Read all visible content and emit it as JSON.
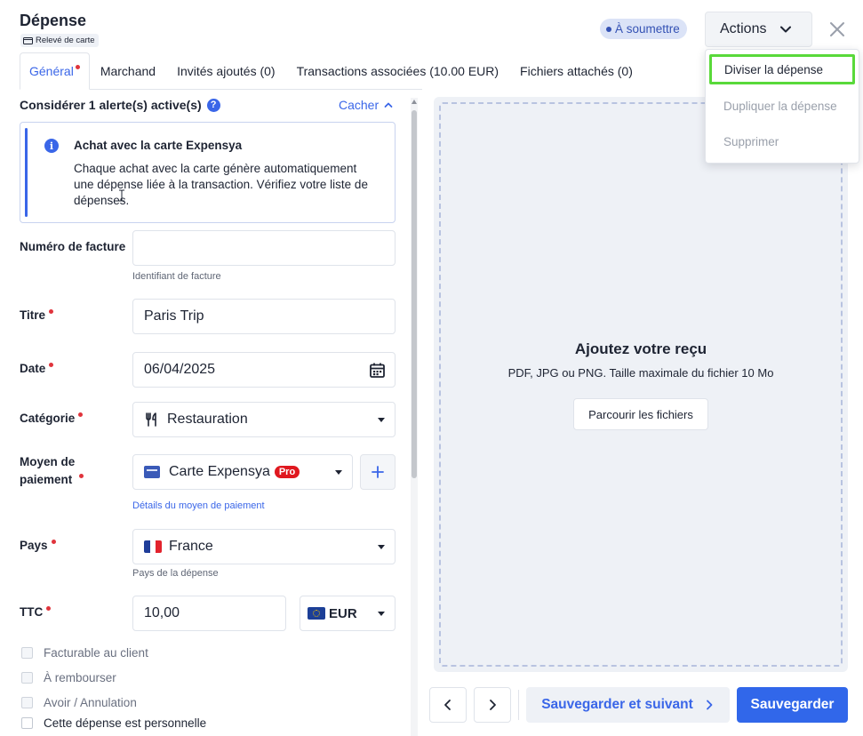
{
  "header": {
    "title": "Dépense",
    "source_badge": "Relevé de carte",
    "status": "À soumettre",
    "actions_label": "Actions"
  },
  "tabs": [
    {
      "label": "Général",
      "active": true,
      "required": true
    },
    {
      "label": "Marchand"
    },
    {
      "label": "Invités ajoutés (0)"
    },
    {
      "label": "Transactions associées (10.00 EUR)"
    },
    {
      "label": "Fichiers attachés (0)"
    }
  ],
  "alerts": {
    "heading": "Considérer 1 alerte(s) active(s)",
    "toggle": "Cacher",
    "box_title": "Achat avec la carte Expensya",
    "box_text": "Chaque achat avec la carte génère automatiquement une dépense liée à la transaction. Vérifiez votre liste de dépenses."
  },
  "form": {
    "invoice": {
      "label": "Numéro de facture",
      "value": "",
      "hint": "Identifiant de facture"
    },
    "title": {
      "label": "Titre",
      "value": "Paris Trip"
    },
    "date": {
      "label": "Date",
      "value": "06/04/2025"
    },
    "category": {
      "label": "Catégorie",
      "value": "Restauration"
    },
    "payment": {
      "label_line1": "Moyen de",
      "label_line2": "paiement",
      "value": "Carte Expensya",
      "badge": "Pro",
      "details_link": "Détails du moyen de paiement"
    },
    "country": {
      "label": "Pays",
      "value": "France",
      "hint": "Pays de la dépense"
    },
    "amount": {
      "label": "TTC",
      "value": "10,00",
      "currency": "EUR"
    },
    "checkboxes": [
      {
        "label": "Facturable au client",
        "enabled": false
      },
      {
        "label": "À rembourser",
        "enabled": false
      },
      {
        "label": "Avoir / Annulation",
        "enabled": false
      },
      {
        "label": "Cette dépense est personnelle",
        "enabled": true
      }
    ]
  },
  "upload": {
    "title": "Ajoutez votre reçu",
    "subtitle": "PDF, JPG ou PNG. Taille maximale du fichier 10 Mo",
    "browse_label": "Parcourir les fichiers"
  },
  "footer": {
    "save_next_label": "Sauvegarder et suivant",
    "save_label": "Sauvegarder"
  },
  "actions_menu": [
    {
      "label": "Diviser la dépense",
      "highlighted": true
    },
    {
      "label": "Dupliquer la dépense",
      "disabled": true
    },
    {
      "label": "Supprimer",
      "disabled": true
    }
  ],
  "colors": {
    "accent": "#3a66e8",
    "primary_button": "#3167ea",
    "required": "#e0343c",
    "highlight": "#59d93a"
  }
}
